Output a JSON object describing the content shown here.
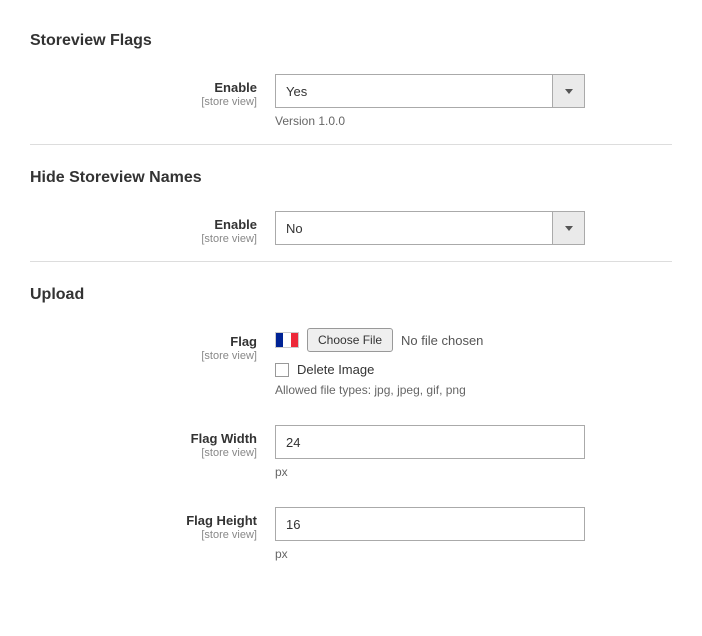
{
  "sections": {
    "storeview_flags": {
      "title": "Storeview Flags",
      "enable": {
        "label": "Enable",
        "scope": "[store view]",
        "value": "Yes",
        "note": "Version 1.0.0"
      }
    },
    "hide_names": {
      "title": "Hide Storeview Names",
      "enable": {
        "label": "Enable",
        "scope": "[store view]",
        "value": "No"
      }
    },
    "upload": {
      "title": "Upload",
      "flag": {
        "label": "Flag",
        "scope": "[store view]",
        "choose_label": "Choose File",
        "status": "No file chosen",
        "delete_label": "Delete Image",
        "allowed_note": "Allowed file types: jpg, jpeg, gif, png",
        "flag_colors": [
          "#002395",
          "#ffffff",
          "#ed2939"
        ]
      },
      "width": {
        "label": "Flag Width",
        "scope": "[store view]",
        "value": "24",
        "unit": "px"
      },
      "height": {
        "label": "Flag Height",
        "scope": "[store view]",
        "value": "16",
        "unit": "px"
      }
    }
  }
}
